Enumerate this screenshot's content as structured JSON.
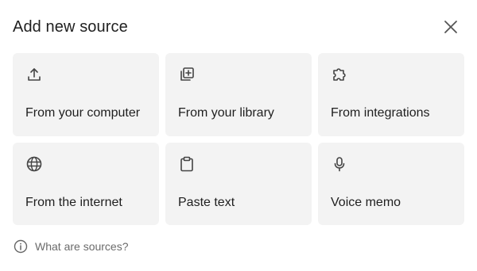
{
  "dialog": {
    "title": "Add new source",
    "close_icon": "close-icon"
  },
  "sources": [
    {
      "label": "From your computer",
      "icon": "upload-icon"
    },
    {
      "label": "From your library",
      "icon": "library-add-icon"
    },
    {
      "label": "From integrations",
      "icon": "puzzle-icon"
    },
    {
      "label": "From the internet",
      "icon": "globe-icon"
    },
    {
      "label": "Paste text",
      "icon": "clipboard-icon"
    },
    {
      "label": "Voice memo",
      "icon": "microphone-icon"
    }
  ],
  "footer": {
    "help_text": "What are sources?",
    "icon": "info-icon"
  },
  "colors": {
    "card_background": "#f3f3f3",
    "text": "#1f1f1f",
    "muted_text": "#6b6b6b",
    "icon": "#444444"
  }
}
